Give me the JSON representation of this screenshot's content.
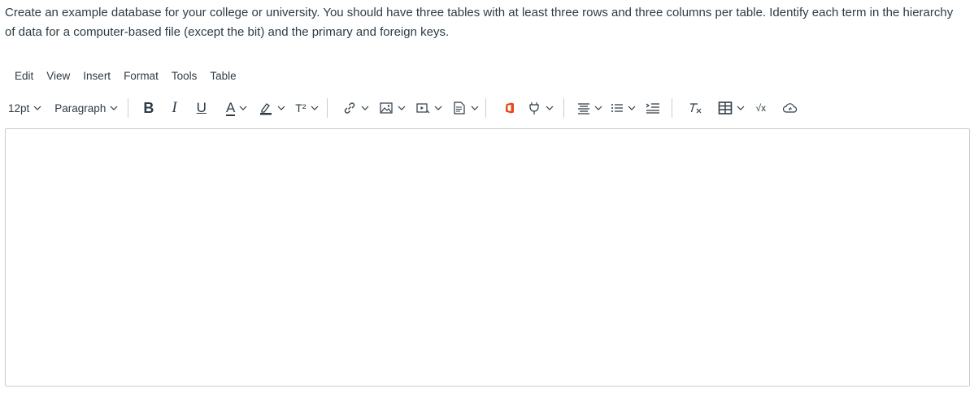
{
  "question": {
    "text": "Create an example database for your college or university. You should have three tables with at least three rows and three columns per table. Identify each term in the hierarchy of data for a computer-based file (except the bit) and the primary and foreign keys."
  },
  "menubar": {
    "items": [
      "Edit",
      "View",
      "Insert",
      "Format",
      "Tools",
      "Table"
    ]
  },
  "toolbar": {
    "font_size": "12pt",
    "block_format": "Paragraph",
    "bold_glyph": "B",
    "italic_glyph": "I",
    "underline_glyph": "U",
    "text_color_glyph": "A",
    "superscript_glyph": "T²",
    "math_glyph": "√x",
    "icons": [
      "link-icon",
      "image-icon",
      "media-icon",
      "document-icon",
      "office-icon",
      "plugin-icon",
      "align-icon",
      "list-icon",
      "indent-icon",
      "clear-format-icon",
      "table-icon",
      "equation-icon",
      "cloud-icon"
    ],
    "colors": {
      "office": "#e64a19",
      "highlight": "#2d3b45",
      "border": "#c7cdd1"
    }
  },
  "editor": {
    "content": ""
  }
}
